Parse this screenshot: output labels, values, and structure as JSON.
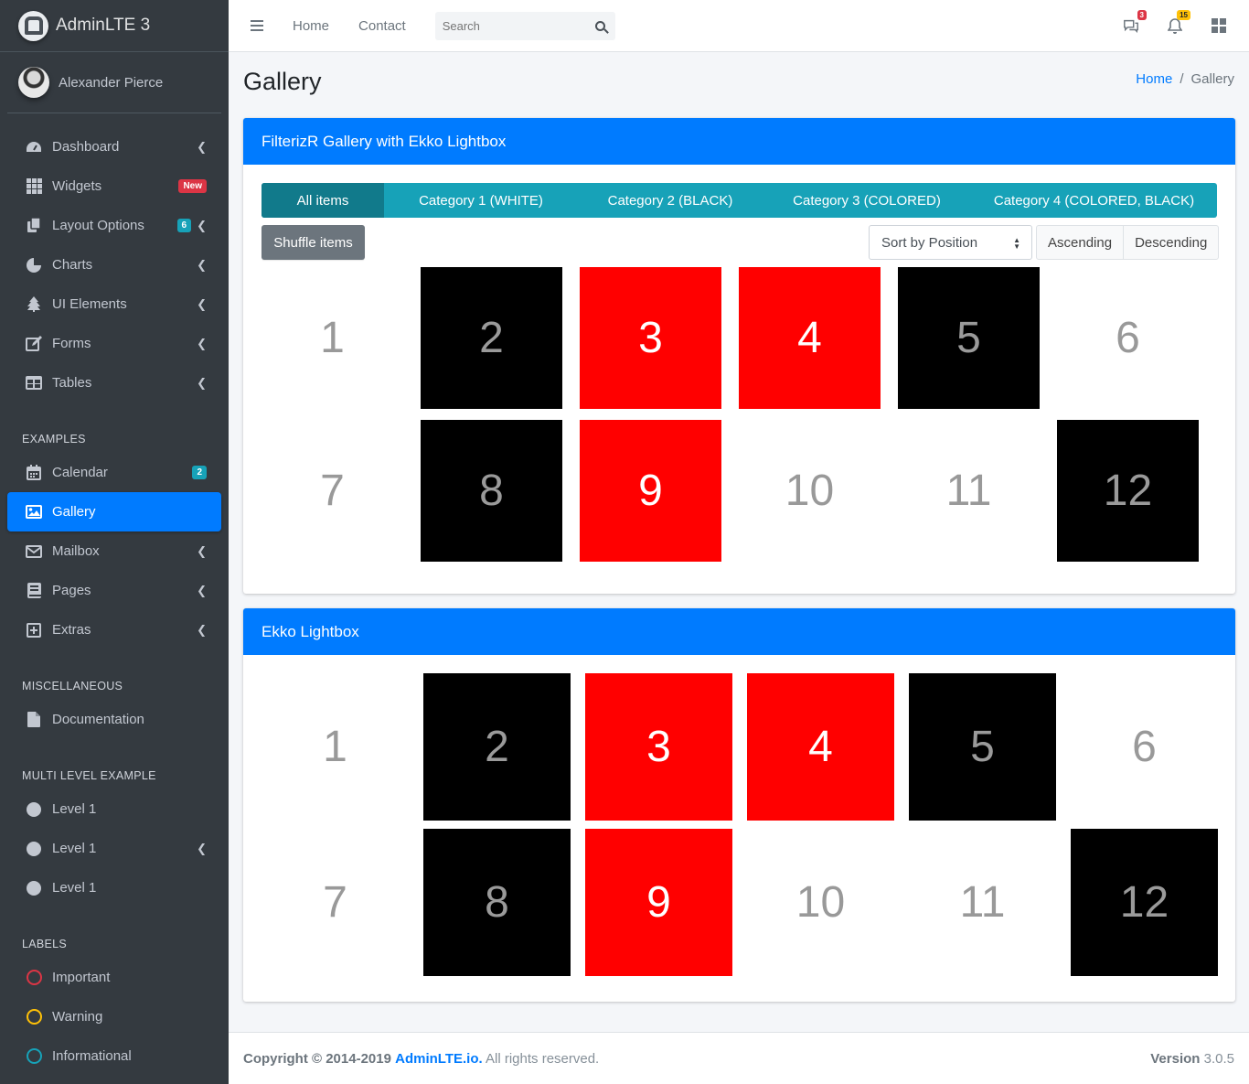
{
  "brand": {
    "name": "AdminLTE 3"
  },
  "user": {
    "name": "Alexander Pierce"
  },
  "sidebar": {
    "items": [
      {
        "label": "Dashboard"
      },
      {
        "label": "Widgets",
        "badge": "New"
      },
      {
        "label": "Layout Options",
        "badge": "6"
      },
      {
        "label": "Charts"
      },
      {
        "label": "UI Elements"
      },
      {
        "label": "Forms"
      },
      {
        "label": "Tables"
      }
    ],
    "examples_header": "EXAMPLES",
    "examples": [
      {
        "label": "Calendar",
        "badge": "2"
      },
      {
        "label": "Gallery"
      },
      {
        "label": "Mailbox"
      },
      {
        "label": "Pages"
      },
      {
        "label": "Extras"
      }
    ],
    "misc_header": "MISCELLANEOUS",
    "misc": [
      {
        "label": "Documentation"
      }
    ],
    "multi_header": "MULTI LEVEL EXAMPLE",
    "multi": [
      {
        "label": "Level 1"
      },
      {
        "label": "Level 1"
      },
      {
        "label": "Level 1"
      }
    ],
    "labels_header": "LABELS",
    "labels": [
      {
        "label": "Important",
        "color": "#dc3545"
      },
      {
        "label": "Warning",
        "color": "#ffc107"
      },
      {
        "label": "Informational",
        "color": "#17a2b8"
      }
    ]
  },
  "navbar": {
    "home": "Home",
    "contact": "Contact",
    "search_placeholder": "Search",
    "messages_count": "3",
    "notifications_count": "15"
  },
  "header": {
    "title": "Gallery",
    "breadcrumb": {
      "home": "Home",
      "current": "Gallery"
    }
  },
  "gallery1": {
    "title": "FilterizR Gallery with Ekko Lightbox",
    "filters": [
      "All items",
      "Category 1 (WHITE)",
      "Category 2 (BLACK)",
      "Category 3 (COLORED)",
      "Category 4 (COLORED, BLACK)"
    ],
    "shuffle": "Shuffle items",
    "sort": "Sort by Position",
    "ascending": "Ascending",
    "descending": "Descending"
  },
  "gallery2": {
    "title": "Ekko Lightbox"
  },
  "tiles": [
    {
      "label": "1",
      "color": "white"
    },
    {
      "label": "2",
      "color": "black"
    },
    {
      "label": "3",
      "color": "red"
    },
    {
      "label": "4",
      "color": "red"
    },
    {
      "label": "5",
      "color": "black"
    },
    {
      "label": "6",
      "color": "white"
    },
    {
      "label": "7",
      "color": "white"
    },
    {
      "label": "8",
      "color": "black"
    },
    {
      "label": "9",
      "color": "red"
    },
    {
      "label": "10",
      "color": "white"
    },
    {
      "label": "11",
      "color": "white"
    },
    {
      "label": "12",
      "color": "black"
    }
  ],
  "footer": {
    "copyright": "Copyright © 2014-2019",
    "link": "AdminLTE.io.",
    "rights": "All rights reserved.",
    "version_label": "Version",
    "version": "3.0.5"
  }
}
